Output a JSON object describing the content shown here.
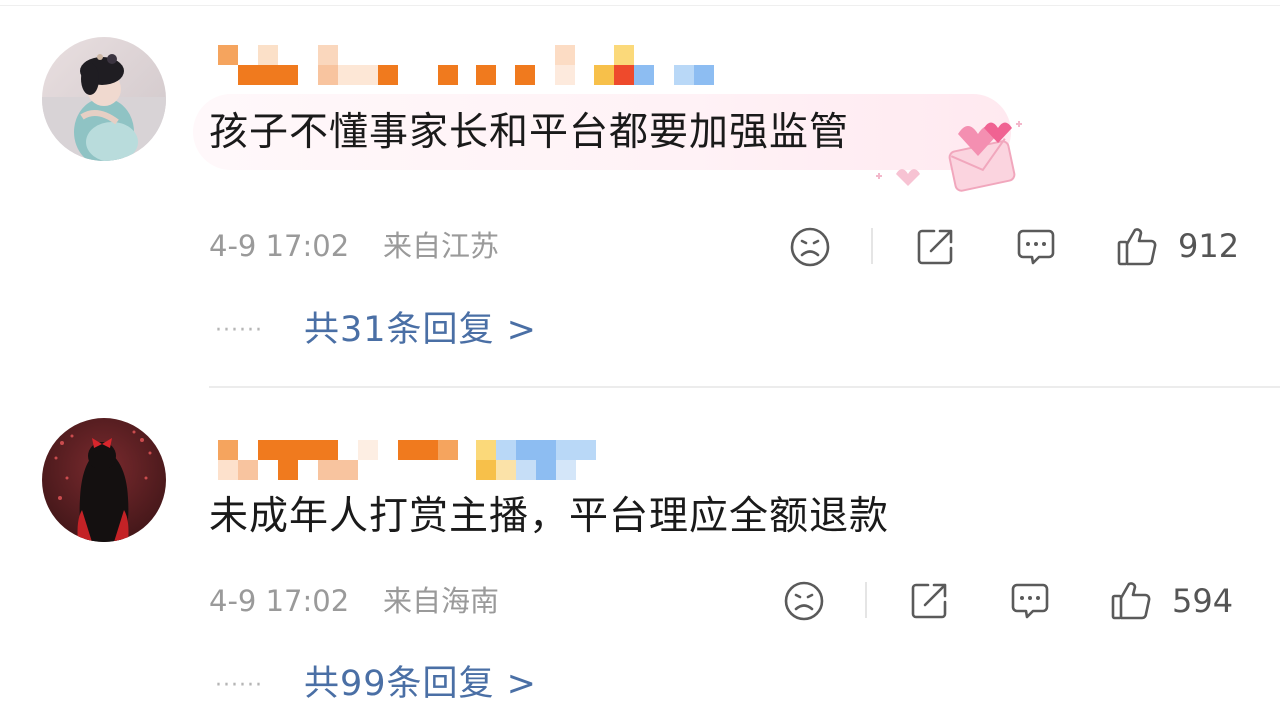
{
  "comments": [
    {
      "text": "孩子不懂事家长和平台都要加强监管",
      "time": "4-9 17:02",
      "location": "来自江苏",
      "likes": "912",
      "replies": "共31条回复 >",
      "dots": "······"
    },
    {
      "text": "未成年人打赏主播，平台理应全额退款",
      "time": "4-9 17:02",
      "location": "来自海南",
      "likes": "594",
      "replies": "共99条回复 >",
      "dots": "······"
    }
  ],
  "colors": {
    "reply_link": "#4a6fa5",
    "meta_text": "#9a9a9a",
    "icon_stroke": "#5a5a5a",
    "mosaic_orange": "#f07a1e",
    "mosaic_blue": "#6aaff0"
  },
  "icons": [
    "sad-face-icon",
    "share-icon",
    "comment-icon",
    "thumbs-up-icon"
  ]
}
